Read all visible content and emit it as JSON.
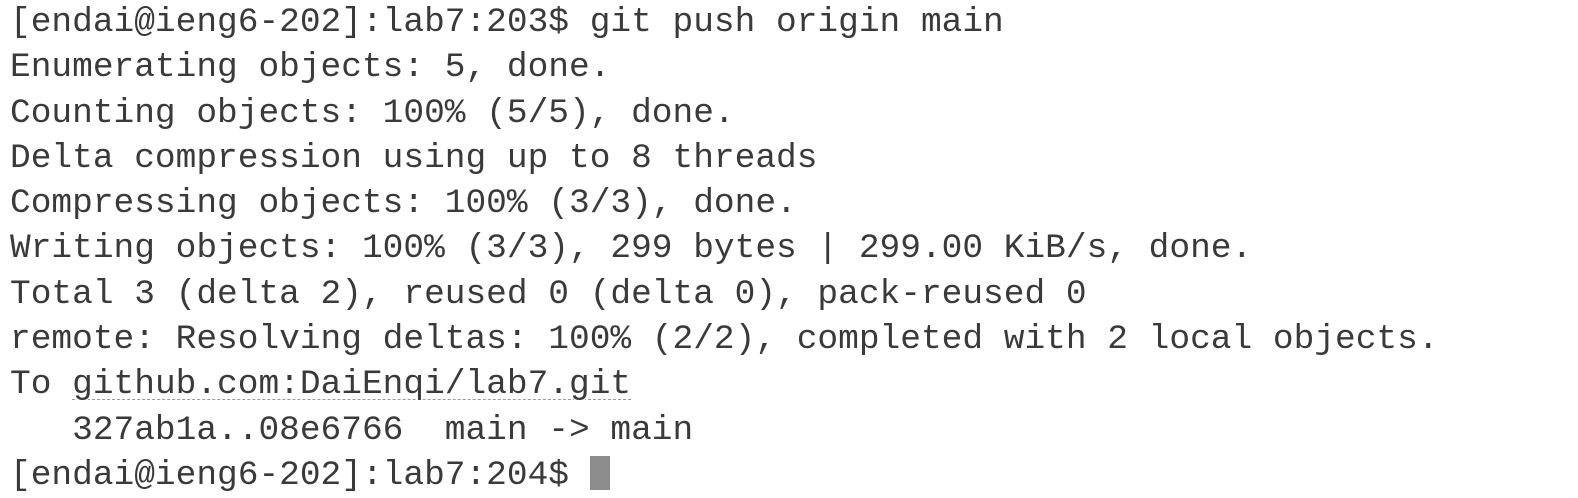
{
  "terminal": {
    "lines": [
      "[endai@ieng6-202]:lab7:203$ git push origin main",
      "Enumerating objects: 5, done.",
      "Counting objects: 100% (5/5), done.",
      "Delta compression using up to 8 threads",
      "Compressing objects: 100% (3/3), done.",
      "Writing objects: 100% (3/3), 299 bytes | 299.00 KiB/s, done.",
      "Total 3 (delta 2), reused 0 (delta 0), pack-reused 0",
      "remote: Resolving deltas: 100% (2/2), completed with 2 local objects."
    ],
    "to_prefix": "To ",
    "to_link": "github.com:DaiEnqi/lab7.git",
    "ref_update": "   327ab1a..08e6766  main -> main",
    "prompt": "[endai@ieng6-202]:lab7:204$ "
  }
}
